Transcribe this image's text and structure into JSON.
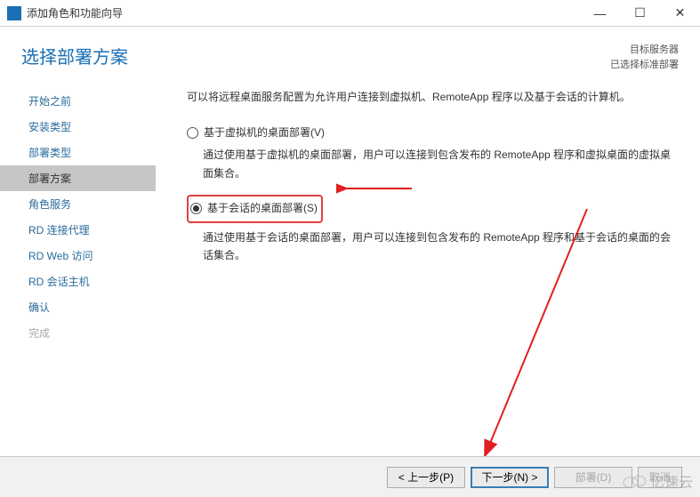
{
  "titlebar": {
    "title": "添加角色和功能向导"
  },
  "header": {
    "page_title": "选择部署方案",
    "target_label": "目标服务器",
    "target_value": "已选择标准部署"
  },
  "sidebar": {
    "items": [
      {
        "label": "开始之前",
        "active": false,
        "disabled": false
      },
      {
        "label": "安装类型",
        "active": false,
        "disabled": false
      },
      {
        "label": "部署类型",
        "active": false,
        "disabled": false
      },
      {
        "label": "部署方案",
        "active": true,
        "disabled": false
      },
      {
        "label": "角色服务",
        "active": false,
        "disabled": false
      },
      {
        "label": "RD 连接代理",
        "active": false,
        "disabled": false
      },
      {
        "label": "RD Web 访问",
        "active": false,
        "disabled": false
      },
      {
        "label": "RD 会话主机",
        "active": false,
        "disabled": false
      },
      {
        "label": "确认",
        "active": false,
        "disabled": false
      },
      {
        "label": "完成",
        "active": false,
        "disabled": true
      }
    ]
  },
  "content": {
    "intro": "可以将远程桌面服务配置为允许用户连接到虚拟机、RemoteApp 程序以及基于会话的计算机。",
    "option1": {
      "label": "基于虚拟机的桌面部署(V)",
      "desc": "通过使用基于虚拟机的桌面部署，用户可以连接到包含发布的 RemoteApp 程序和虚拟桌面的虚拟桌面集合。"
    },
    "option2": {
      "label": "基于会话的桌面部署(S)",
      "desc": "通过使用基于会话的桌面部署，用户可以连接到包含发布的 RemoteApp 程序和基于会话的桌面的会话集合。"
    }
  },
  "footer": {
    "prev": "< 上一步(P)",
    "next": "下一步(N) >",
    "deploy": "部署(D)",
    "cancel": "取消"
  },
  "watermark": {
    "text": "亿速云"
  }
}
